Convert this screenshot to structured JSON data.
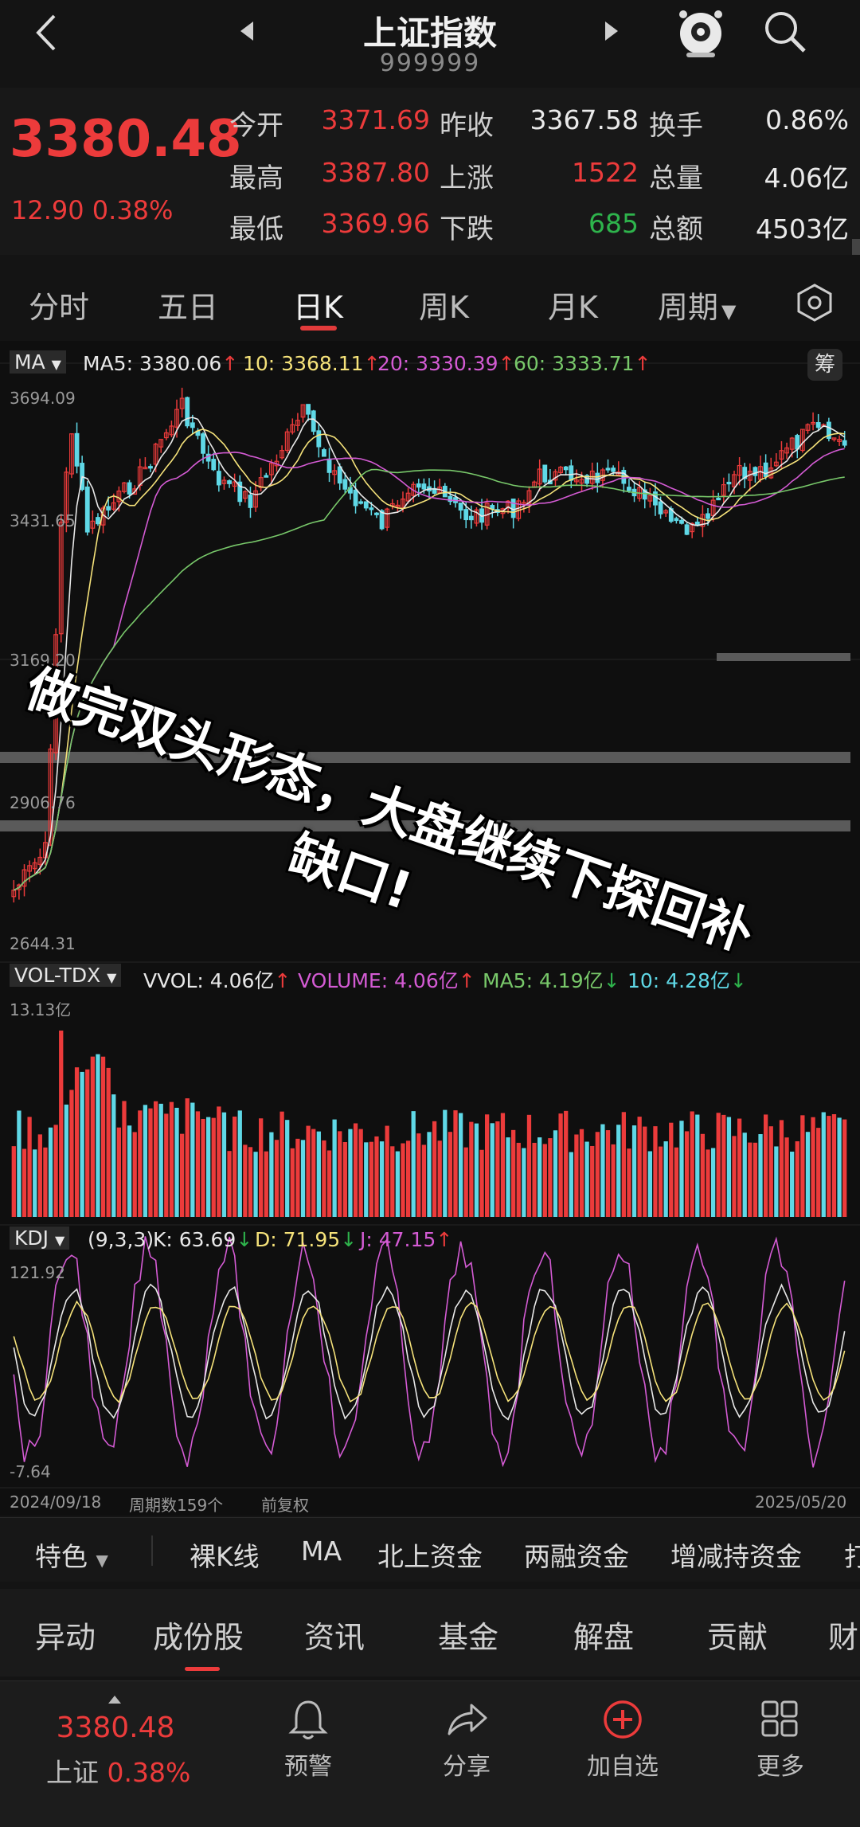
{
  "header": {
    "title": "上证指数",
    "code": "999999"
  },
  "quote": {
    "price": "3380.48",
    "change": "12.90",
    "change_pct": "0.38%",
    "rows": [
      {
        "l1": "今开",
        "v1": "3371.69",
        "l2": "昨收",
        "v2": "3367.58",
        "l3": "换手",
        "v3": "0.86%"
      },
      {
        "l1": "最高",
        "v1": "3387.80",
        "l2": "上涨",
        "v2": "1522",
        "l3": "总量",
        "v3": "4.06亿"
      },
      {
        "l1": "最低",
        "v1": "3369.96",
        "l2": "下跌",
        "v2": "685",
        "l3": "总额",
        "v3": "4503亿"
      }
    ]
  },
  "tabs": [
    "分时",
    "五日",
    "日K",
    "周K",
    "月K",
    "周期"
  ],
  "ma_legend": {
    "name": "MA",
    "ma5": "MA5: 3380.06",
    "ma10": "10: 3368.11",
    "ma20": "20: 3330.39",
    "ma60": "60: 3333.71",
    "chip_btn": "筹"
  },
  "price_axis": [
    "3694.09",
    "3431.65",
    "3169.20",
    "2906.76",
    "2644.31"
  ],
  "vol_legend": {
    "name": "VOL-TDX",
    "vvol": "VVOL: 4.06亿",
    "volume": "VOLUME: 4.06亿",
    "ma5": "MA5: 4.19亿",
    "ma10": "10: 4.28亿",
    "axis_top": "13.13亿"
  },
  "kdj_legend": {
    "name": "KDJ",
    "params": "(9,3,3)",
    "k": "K: 63.69",
    "d": "D: 71.95",
    "j": "J: 47.15",
    "axis_top": "121.92",
    "axis_bottom": "-7.64"
  },
  "date_axis": {
    "start": "2024/09/18",
    "period_count": "周期数159个",
    "adjust": "前复权",
    "end": "2025/05/20"
  },
  "overlay_text": [
    "做完双头形态，大盘继续下探回补",
    "缺口!"
  ],
  "indicators": {
    "feature": "特色",
    "items": [
      "裸K线",
      "MA",
      "北上资金",
      "两融资金",
      "增减持资金",
      "打"
    ]
  },
  "subtabs": [
    "异动",
    "成份股",
    "资讯",
    "基金",
    "解盘",
    "贡献",
    "财"
  ],
  "footer": {
    "price": "3380.48",
    "name": "上证",
    "pct": "0.38%",
    "buttons": [
      "预警",
      "分享",
      "加自选",
      "更多"
    ]
  },
  "colors": {
    "up": "#ec3b3b",
    "down": "#5fd8e6",
    "ma5": "#e8e8e8",
    "ma10": "#f5e27a",
    "ma20": "#d45bd4",
    "ma60": "#78c86a"
  }
}
